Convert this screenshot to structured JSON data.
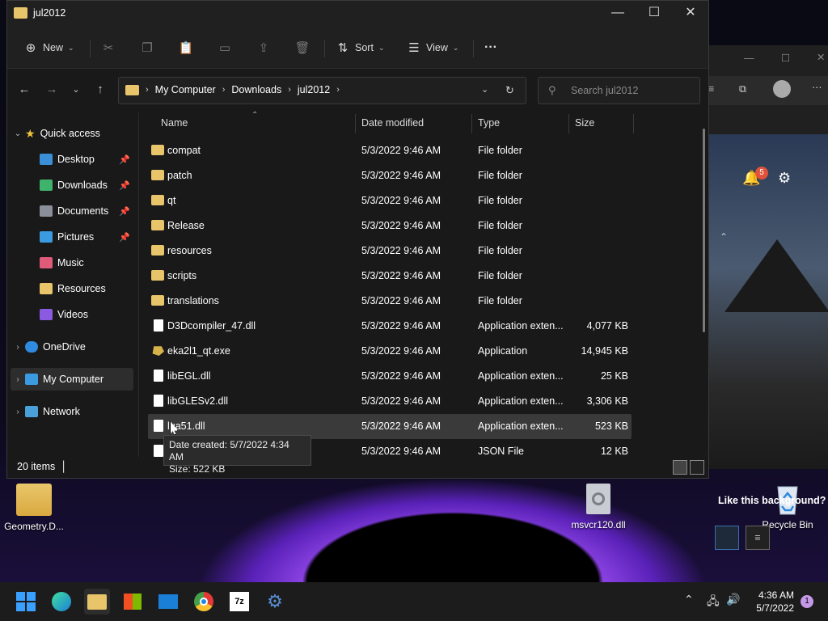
{
  "desktop": {
    "icons": [
      {
        "label": "Geometry.D..."
      },
      {
        "label": "msvcr120.dll"
      },
      {
        "label": "Recycle Bin"
      }
    ]
  },
  "background_window": {
    "bell_badge": "5",
    "text": "Like this background?"
  },
  "window": {
    "title": "jul2012",
    "toolbar": {
      "new_label": "New",
      "sort_label": "Sort",
      "view_label": "View",
      "more_label": "···"
    },
    "breadcrumbs": [
      "My Computer",
      "Downloads",
      "jul2012"
    ],
    "search_placeholder": "Search jul2012",
    "columns": {
      "name": "Name",
      "date": "Date modified",
      "type": "Type",
      "size": "Size"
    },
    "nav": {
      "quick_access": "Quick access",
      "items": [
        {
          "label": "Desktop",
          "pinned": true,
          "color": "#3a8fd6"
        },
        {
          "label": "Downloads",
          "pinned": true,
          "color": "#3fb36b"
        },
        {
          "label": "Documents",
          "pinned": true,
          "color": "#8a8f99"
        },
        {
          "label": "Pictures",
          "pinned": true,
          "color": "#3a9be0"
        },
        {
          "label": "Music",
          "pinned": false,
          "color": "#e05a7a"
        },
        {
          "label": "Resources",
          "pinned": false,
          "color": "#e8c46a"
        },
        {
          "label": "Videos",
          "pinned": false,
          "color": "#8a5ae0"
        }
      ],
      "onedrive": "OneDrive",
      "my_computer": "My Computer",
      "network": "Network"
    },
    "files": [
      {
        "name": "compat",
        "date": "5/3/2022 9:46 AM",
        "type": "File folder",
        "size": "",
        "kind": "folder"
      },
      {
        "name": "patch",
        "date": "5/3/2022 9:46 AM",
        "type": "File folder",
        "size": "",
        "kind": "folder"
      },
      {
        "name": "qt",
        "date": "5/3/2022 9:46 AM",
        "type": "File folder",
        "size": "",
        "kind": "folder"
      },
      {
        "name": "Release",
        "date": "5/3/2022 9:46 AM",
        "type": "File folder",
        "size": "",
        "kind": "folder"
      },
      {
        "name": "resources",
        "date": "5/3/2022 9:46 AM",
        "type": "File folder",
        "size": "",
        "kind": "folder"
      },
      {
        "name": "scripts",
        "date": "5/3/2022 9:46 AM",
        "type": "File folder",
        "size": "",
        "kind": "folder"
      },
      {
        "name": "translations",
        "date": "5/3/2022 9:46 AM",
        "type": "File folder",
        "size": "",
        "kind": "folder"
      },
      {
        "name": "D3Dcompiler_47.dll",
        "date": "5/3/2022 9:46 AM",
        "type": "Application exten...",
        "size": "4,077 KB",
        "kind": "file"
      },
      {
        "name": "eka2l1_qt.exe",
        "date": "5/3/2022 9:46 AM",
        "type": "Application",
        "size": "14,945 KB",
        "kind": "exe"
      },
      {
        "name": "libEGL.dll",
        "date": "5/3/2022 9:46 AM",
        "type": "Application exten...",
        "size": "25 KB",
        "kind": "file"
      },
      {
        "name": "libGLESv2.dll",
        "date": "5/3/2022 9:46 AM",
        "type": "Application exten...",
        "size": "3,306 KB",
        "kind": "file"
      },
      {
        "name": "lua51.dll",
        "date": "5/3/2022 9:46 AM",
        "type": "Application exten...",
        "size": "523 KB",
        "kind": "file"
      },
      {
        "name": "r",
        "date": "5/3/2022 9:46 AM",
        "type": "JSON File",
        "size": "12 KB",
        "kind": "file"
      }
    ],
    "tooltip": {
      "line1": "Date created: 5/7/2022 4:34 AM",
      "line2": "Size: 522 KB"
    },
    "status_count": "20 items"
  },
  "taskbar": {
    "time": "4:36 AM",
    "date": "5/7/2022",
    "notification_count": "1",
    "apps": [
      "start-icon",
      "edge-icon",
      "file-explorer-icon",
      "store-icon",
      "mail-icon",
      "chrome-icon",
      "7zip-icon",
      "settings-icon"
    ]
  }
}
